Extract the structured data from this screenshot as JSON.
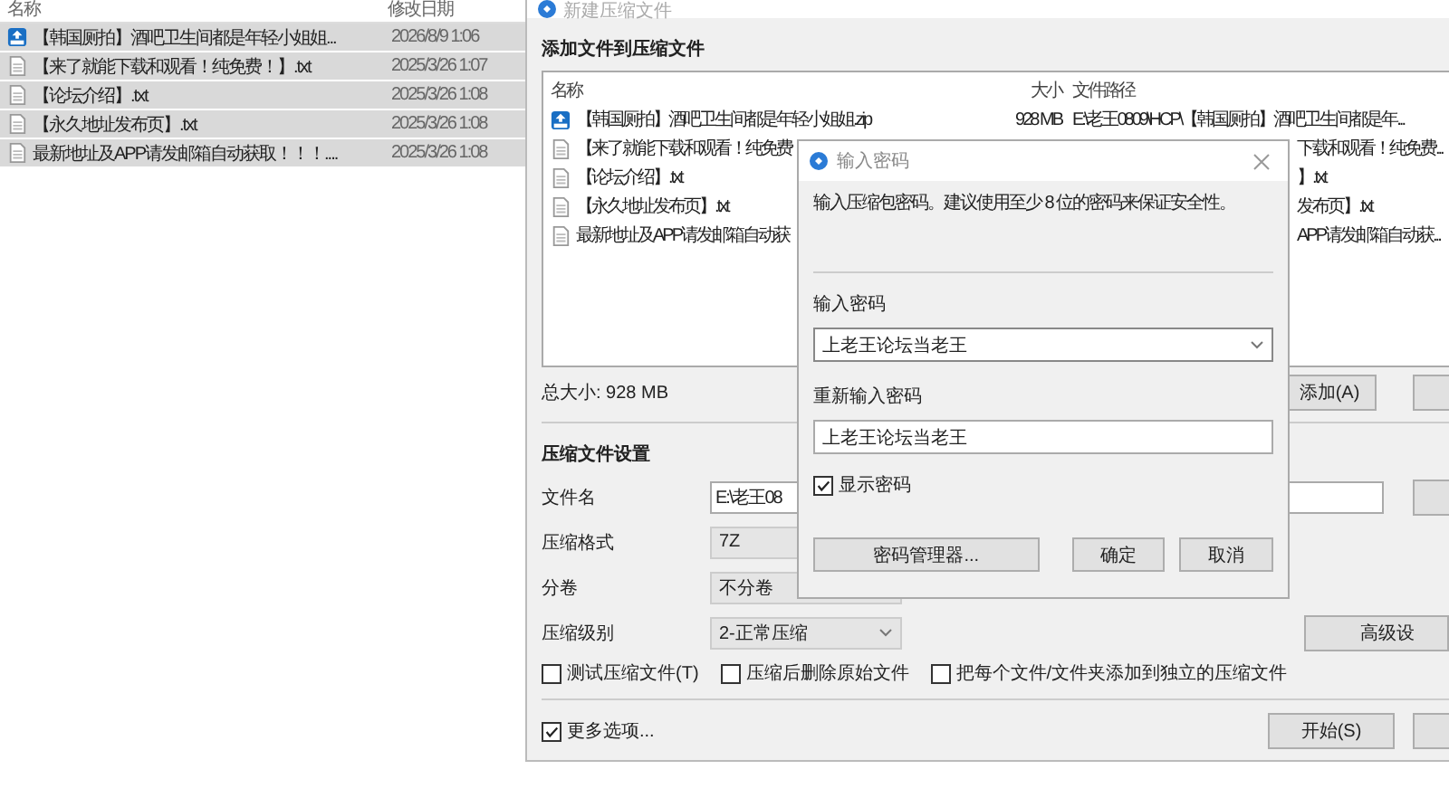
{
  "explorer": {
    "columns": [
      "名称",
      "修改日期"
    ],
    "rows": [
      {
        "name": "【韩国厕拍】酒吧卫生间都是年轻小姐姐...",
        "date": "2026/8/9 1:06",
        "kind": "zip",
        "selected": true
      },
      {
        "name": "【来了就能下载和观看！纯免费！】.txt",
        "date": "2025/3/26 1:07",
        "kind": "txt",
        "selected": true
      },
      {
        "name": "【论坛介绍】.txt",
        "date": "2025/3/26 1:08",
        "kind": "txt",
        "selected": true
      },
      {
        "name": "【永久地址发布页】.txt",
        "date": "2025/3/26 1:08",
        "kind": "txt",
        "selected": true
      },
      {
        "name": "最新地址及APP请发邮箱自动获取！！！....",
        "date": "2025/3/26 1:08",
        "kind": "txt",
        "selected": true
      }
    ]
  },
  "archive_dialog": {
    "title": "新建压缩文件",
    "heading": "添加文件到压缩文件",
    "file_list": {
      "columns": [
        "名称",
        "大小",
        "文件路径"
      ],
      "rows": [
        {
          "kind": "archive",
          "name": "【韩国厕拍】酒吧卫生间都是年轻小姐姐.zip",
          "size": "928 MB",
          "path": "E:\\老王0809\\HCP\\【韩国厕拍】酒吧卫生间都是年..."
        },
        {
          "kind": "document",
          "name": "【来了就能下载和观看！纯免费",
          "path": "下载和观看！纯免费..."
        },
        {
          "kind": "document",
          "name": "【论坛介绍】.txt",
          "path": "】.txt"
        },
        {
          "kind": "document",
          "name": "【永久地址发布页】.txt",
          "path": "发布页】.txt"
        },
        {
          "kind": "document",
          "name": "最新地址及APP请发邮箱自动获",
          "path": "APP请发邮箱自动获..."
        }
      ]
    },
    "total_size": "总大小: 928 MB",
    "add_button": "添加(A)",
    "settings_heading": "压缩文件设置",
    "settings": [
      {
        "label": "文件名",
        "kind": "input",
        "value": "E:\\老王08"
      },
      {
        "label": "压缩格式",
        "kind": "select",
        "value": "7Z"
      },
      {
        "label": "分卷",
        "kind": "select",
        "value": "不分卷"
      },
      {
        "label": "压缩级别",
        "kind": "select",
        "value": "2-正常压缩"
      }
    ],
    "advanced_button": "高级设",
    "options": [
      {
        "label": "测试压缩文件(T)",
        "checked": false
      },
      {
        "label": "压缩后删除原始文件",
        "checked": false
      },
      {
        "label": "把每个文件/文件夹添加到独立的压缩文件",
        "checked": false
      }
    ],
    "more_options": {
      "label": "更多选项...",
      "checked": true
    },
    "start_button": "开始(S)"
  },
  "password_dialog": {
    "title": "输入密码",
    "description": "输入压缩包密码。建议使用至少 8 位的密码来保证安全性。",
    "password_label": "输入密码",
    "password_value": "上老王论坛当老王",
    "confirm_label": "重新输入密码",
    "confirm_value": "上老王论坛当老王",
    "show_password": {
      "label": "显示密码",
      "checked": true
    },
    "buttons": [
      "密码管理器...",
      "确定",
      "取消"
    ]
  }
}
